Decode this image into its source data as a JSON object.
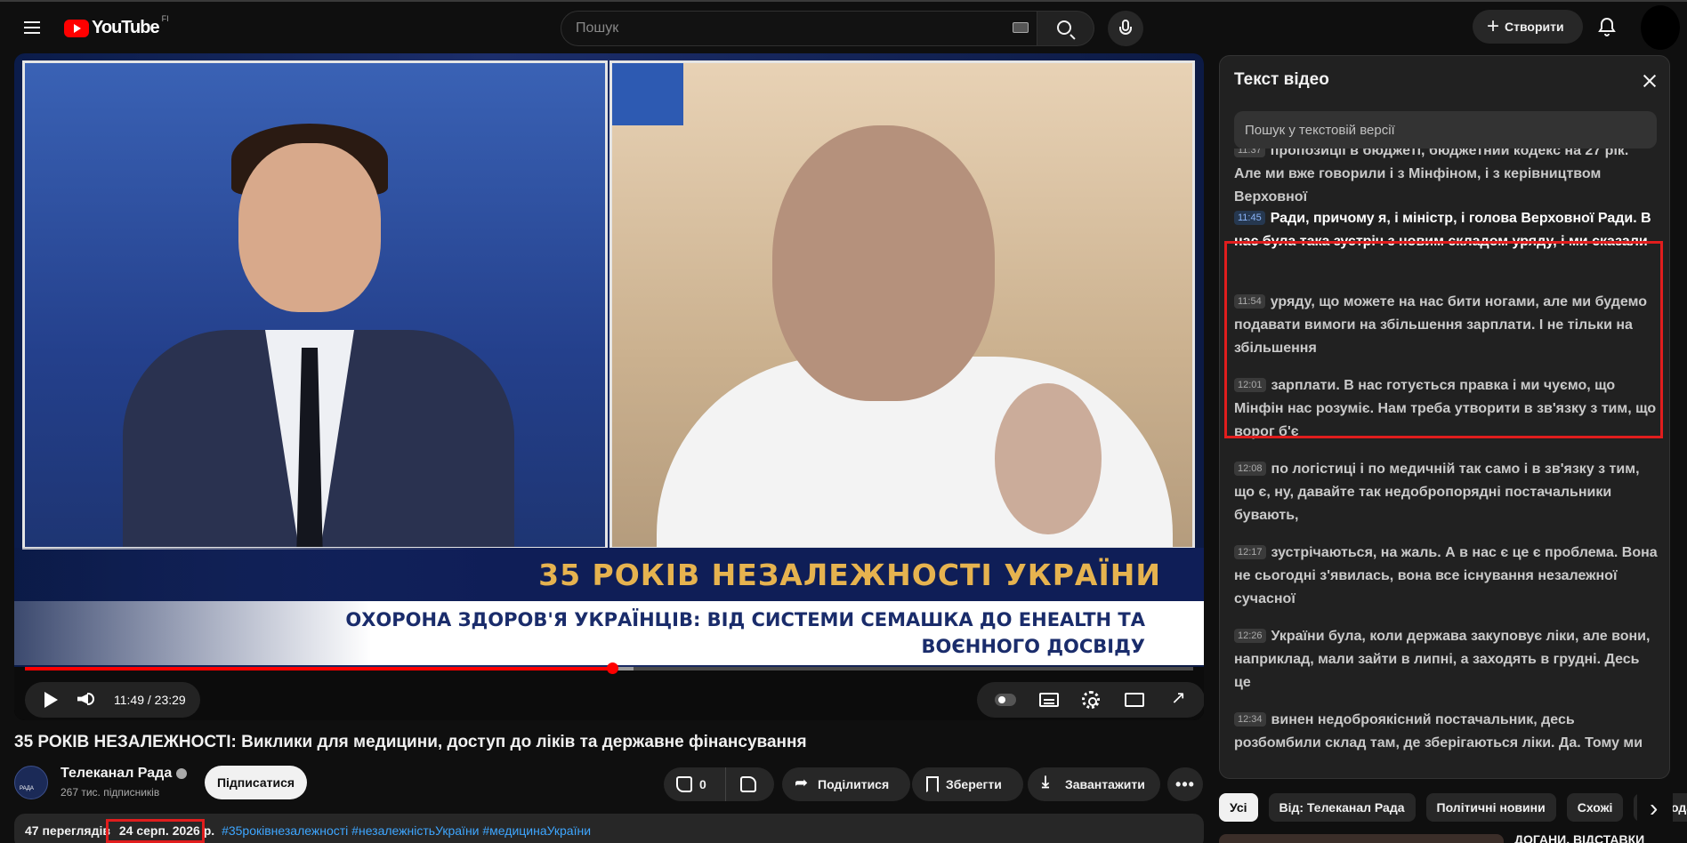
{
  "header": {
    "logo_text": "YouTube",
    "logo_region": "FI",
    "search_placeholder": "Пошук",
    "create_label": "Створити"
  },
  "player": {
    "overlay_line1": "35 РОКІВ НЕЗАЛЕЖНОСТІ УКРАЇНИ",
    "overlay_line2": "ОХОРОНА ЗДОРОВ'Я УКРАЇНЦІВ: ВІД СИСТЕМИ СЕМАШКА ДО EHEALTH ТА",
    "overlay_line3": "ВОЄННОГО ДОСВІДУ",
    "time_display": "11:49 / 23:29",
    "progress_fraction": 0.5028,
    "buffer_fraction": 0.521,
    "colors": {
      "progress": "#ff0000",
      "overlay_gold": "#e6b34f",
      "overlay_navy": "#0f1e57"
    }
  },
  "video": {
    "title": "35 РОКІВ НЕЗАЛЕЖНОСТІ: Виклики для медицини, доступ до ліків та державне фінансування",
    "channel_name": "Телеканал Рада",
    "subscribers": "267 тис. підписників",
    "subscribe_label": "Підписатися",
    "like_count": "0",
    "share_label": "Поділитися",
    "save_label": "Зберегти",
    "download_label": "Завантажити",
    "views": "47 переглядів",
    "date": "24 серп. 2026 р.",
    "tags": "#35роківнезалежності #незалежністьУкраїни #медицинаУкраїни"
  },
  "transcript": {
    "title": "Текст відео",
    "search_placeholder": "Пошук у текстовій версії",
    "segments": [
      {
        "time": "11:37",
        "text": "пропозиції в бюджеті, бюджетний кодекс на 27 рік. Але ми вже говорили і з Мінфіном, і з керівництвом Верховної"
      },
      {
        "time": "11:45",
        "text": "Ради, причому я, і міністр, і голова Верховної Ради. В нас була така зустріч з новим складом уряду, і ми сказали",
        "active": true
      },
      {
        "time": "11:54",
        "text": "уряду, що можете на нас бити ногами, але ми будемо подавати вимоги на збільшення зарплати. І не тільки на збільшення"
      },
      {
        "time": "12:01",
        "text": "зарплати. В нас готується правка і ми чуємо, що Мінфін нас розуміє. Нам треба утворити в зв'язку з тим, що ворог б'є"
      },
      {
        "time": "12:08",
        "text": "по логістиці і по медичній так само і в зв'язку з тим, що є, ну, давайте так недобропорядні постачальники бувають,"
      },
      {
        "time": "12:17",
        "text": "зустрічаються, на жаль. А в нас є це є проблема. Вона не сьогодні з'явилась, вона все існування незалежної сучасної"
      },
      {
        "time": "12:26",
        "text": "України була, коли держава закуповує ліки, але вони, наприклад, мали зайти в липні, а заходять в грудні. Десь це"
      },
      {
        "time": "12:34",
        "text": "винен недоброякісний постачальник, десь розбомбили склад там, де зберігаються ліки. Да. Тому ми"
      }
    ]
  },
  "chips": [
    "Усі",
    "Від: Телеканал Рада",
    "Політичні новини",
    "Схожі",
    "Нещодавно завантажені"
  ],
  "recommendation": {
    "title": "ДОГАНИ, ВІДСТАВКИ"
  }
}
